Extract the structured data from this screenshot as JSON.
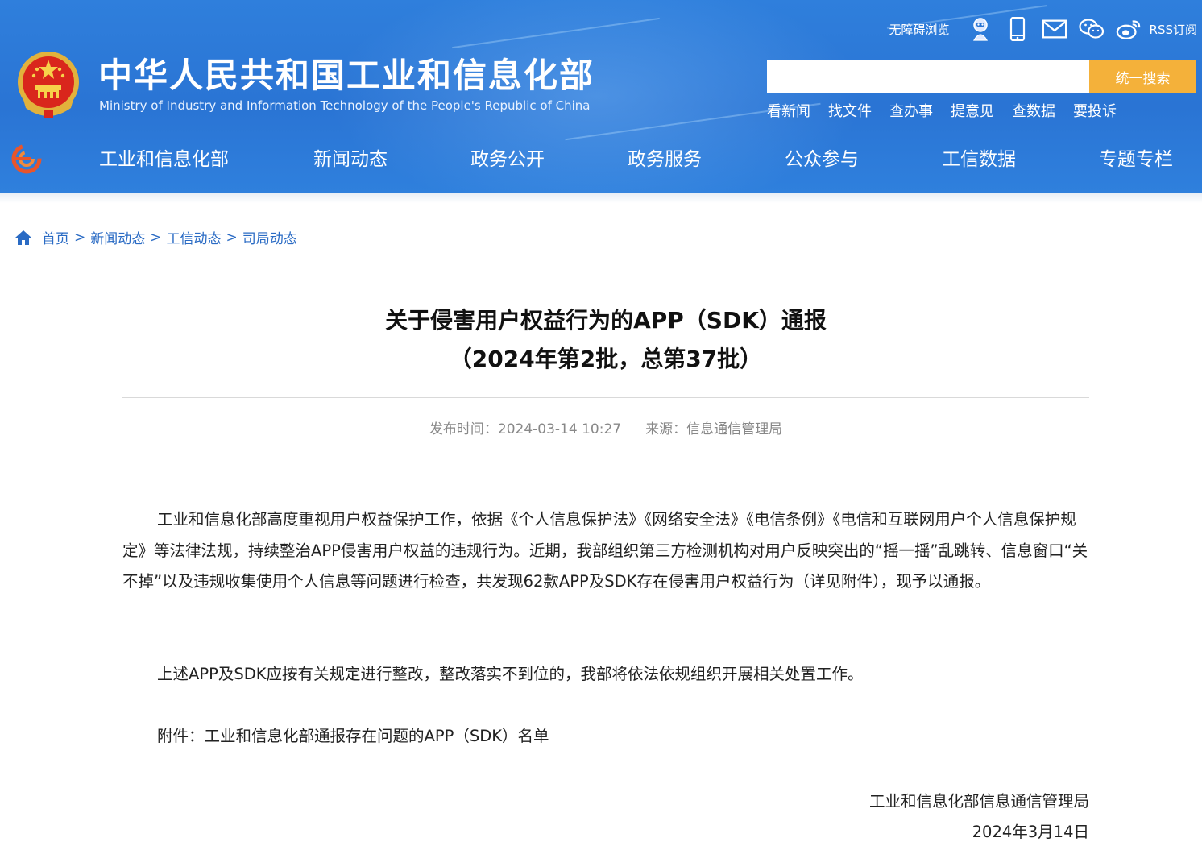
{
  "header": {
    "title_cn": "中华人民共和国工业和信息化部",
    "title_en": "Ministry of Industry and Information Technology of the People's Republic of China",
    "accessibility_label": "无障碍浏览",
    "rss_label": "RSS订阅",
    "search": {
      "placeholder": "",
      "button_label": "统一搜索"
    },
    "quick_links": [
      "看新闻",
      "找文件",
      "查办事",
      "提意见",
      "查数据",
      "要投诉"
    ]
  },
  "nav": {
    "items": [
      "工业和信息化部",
      "新闻动态",
      "政务公开",
      "政务服务",
      "公众参与",
      "工信数据",
      "专题专栏"
    ]
  },
  "breadcrumb": {
    "items": [
      "首页",
      "新闻动态",
      "工信动态",
      "司局动态"
    ],
    "separator": ">"
  },
  "article": {
    "title_line1": "关于侵害用户权益行为的APP（SDK）通报",
    "title_line2": "（2024年第2批，总第37批）",
    "publish_label": "发布时间：",
    "publish_time": "2024-03-14 10:27",
    "source_label": "来源：",
    "source": "信息通信管理局",
    "paragraphs": [
      "工业和信息化部高度重视用户权益保护工作，依据《个人信息保护法》《网络安全法》《电信条例》《电信和互联网用户个人信息保护规定》等法律法规，持续整治APP侵害用户权益的违规行为。近期，我部组织第三方检测机构对用户反映突出的“摇一摇”乱跳转、信息窗口“关不掉”以及违规收集使用个人信息等问题进行检查，共发现62款APP及SDK存在侵害用户权益行为（详见附件），现予以通报。",
      "上述APP及SDK应按有关规定进行整改，整改落实不到位的，我部将依法依规组织开展相关处置工作。",
      "附件：工业和信息化部通报存在问题的APP（SDK）名单"
    ],
    "signature_org": "工业和信息化部信息通信管理局",
    "signature_date": "2024年3月14日"
  },
  "colors": {
    "header_blue": "#2a74d4",
    "search_button": "#f4b13a",
    "link_blue": "#2a6bc4",
    "meta_gray": "#888888"
  },
  "icons": [
    "national-emblem-icon",
    "accessibility-robot-icon",
    "mobile-icon",
    "mail-icon",
    "wechat-icon",
    "weibo-icon",
    "ministry-logo-icon",
    "home-icon"
  ]
}
